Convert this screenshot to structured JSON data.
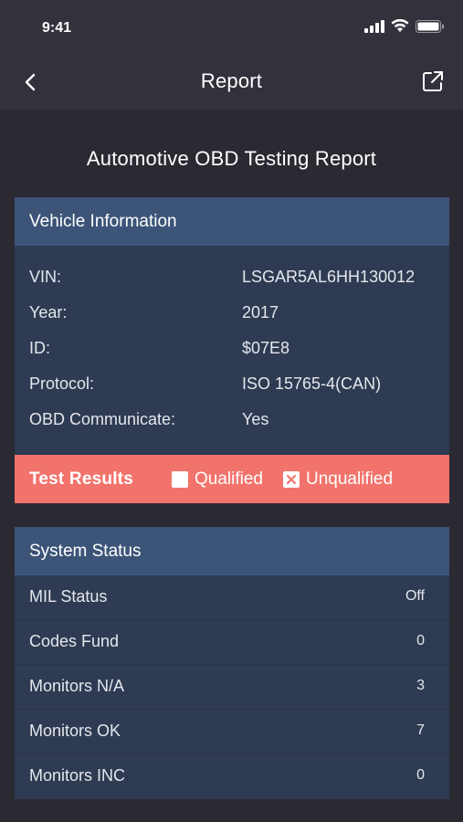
{
  "status_bar": {
    "time": "9:41"
  },
  "nav": {
    "title": "Report"
  },
  "report_title": "Automotive OBD Testing Report",
  "vehicle": {
    "header": "Vehicle Information",
    "rows": [
      {
        "label": "VIN:",
        "value": "LSGAR5AL6HH130012"
      },
      {
        "label": "Year:",
        "value": "2017"
      },
      {
        "label": "ID:",
        "value": "$07E8"
      },
      {
        "label": "Protocol:",
        "value": "ISO 15765-4(CAN)"
      },
      {
        "label": "OBD Communicate:",
        "value": "Yes"
      }
    ]
  },
  "test_results": {
    "label": "Test Results",
    "qualified_label": "Qualified",
    "unqualified_label": "Unqualified",
    "qualified_checked": false,
    "unqualified_checked": true
  },
  "system_status": {
    "header": "System Status",
    "rows": [
      {
        "label": "MIL Status",
        "value": "Off"
      },
      {
        "label": "Codes Fund",
        "value": "0"
      },
      {
        "label": "Monitors N/A",
        "value": "3"
      },
      {
        "label": "Monitors OK",
        "value": "7"
      },
      {
        "label": "Monitors INC",
        "value": "0"
      }
    ]
  },
  "colors": {
    "background": "#2b2a33",
    "card_header": "#3c5478",
    "card_body": "#2f3b52",
    "results_bar": "#f2736c"
  }
}
